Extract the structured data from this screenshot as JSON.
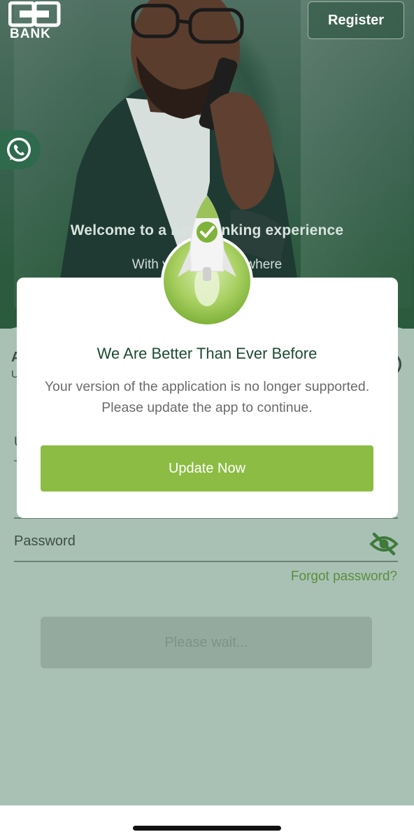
{
  "header": {
    "logo_text": "BANK",
    "register_label": "Register"
  },
  "hero": {
    "title": "Welcome to a new banking experience",
    "subtitle": "With your bank anywhere"
  },
  "login": {
    "password_label": "Password",
    "forgot_label": "Forgot password?",
    "wait_label": "Please wait...",
    "partial_label_a": "A",
    "partial_label_u1": "U",
    "partial_label_u2": "U"
  },
  "modal": {
    "title": "We Are Better Than Ever Before",
    "message": "Your version of the application is no longer supported. Please update the app to continue.",
    "update_label": "Update Now"
  },
  "colors": {
    "brand_green": "#8cbc43",
    "dark_green": "#1d4a33",
    "panel": "#a9c1b5"
  },
  "icons": [
    "coop-logo-icon",
    "whatsapp-icon",
    "rocket-icon",
    "checkmark-icon",
    "eye-off-icon"
  ]
}
